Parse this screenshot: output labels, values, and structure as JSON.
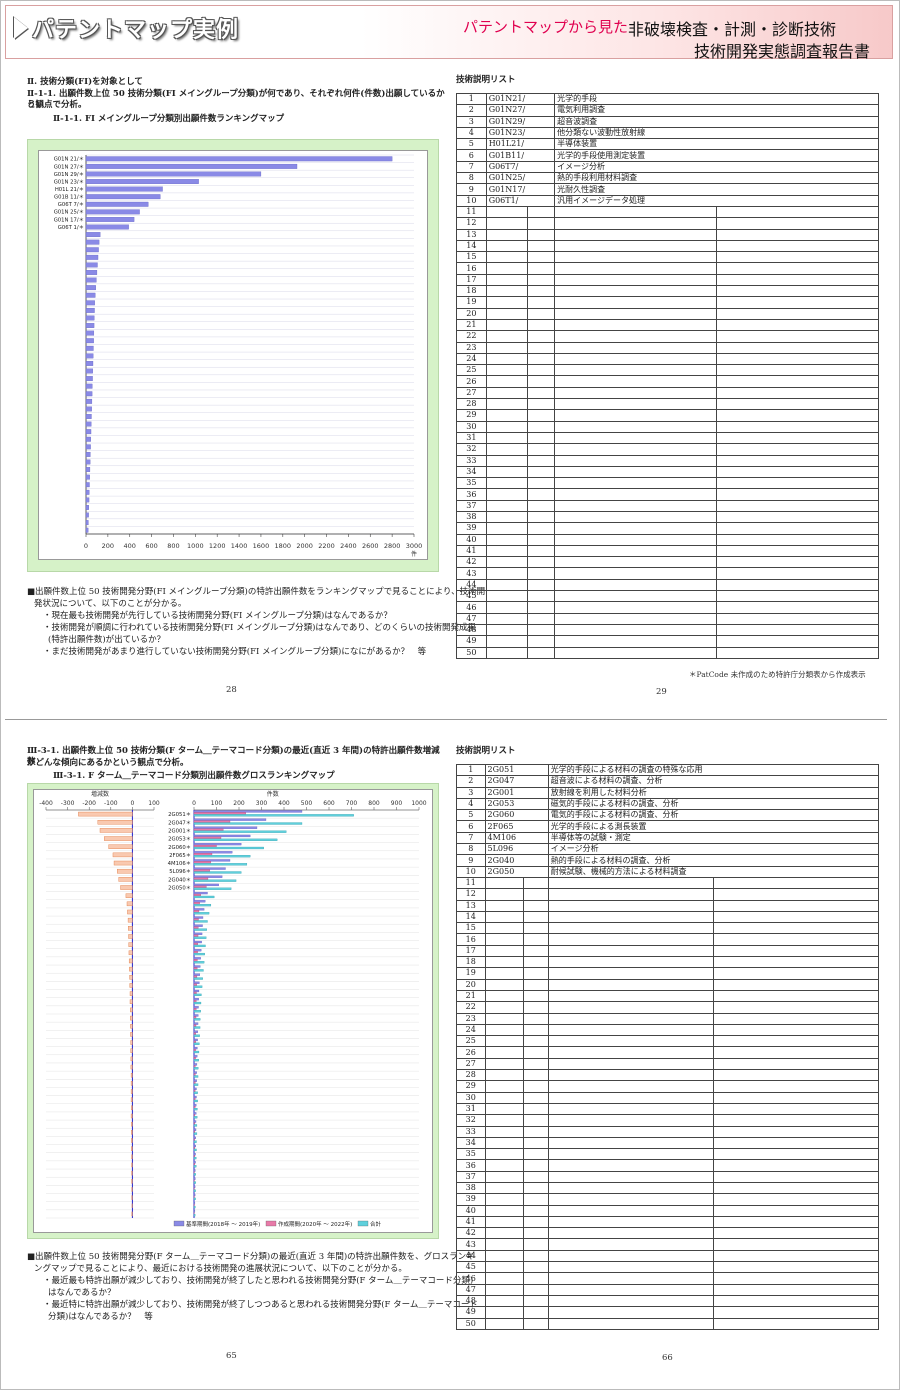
{
  "banner": {
    "title": "パテントマップ実例",
    "sub_pink": "パテントマップから見た",
    "sub_main": "非破壊検査・計測・診断技術",
    "sub_report": "技術開発実態調査報告書"
  },
  "p1": {
    "heading1": "Ⅱ. 技術分類(FI)を対象として",
    "heading2a": "Ⅱ-1-1. 出願件数上位 50 技術分類(FI メイングループ分類)が何であり、それぞれ何件(件数)出願しているかとい",
    "heading2b": "う観点で分析。",
    "chart_title": "Ⅱ-1-1. FI メイングループ分類別出願件数ランキングマップ",
    "para1": "■出願件数上位 50 技術開発分野(FI メイングループ分類)の特許出願件数をランキングマップで見ることにより、技術開",
    "para2": "発状況について、以下のことが分かる。",
    "b1": "・現在最も技術開発が先行している技術開発分野(FI メイングループ分類)はなんであるか？",
    "b2": "・技術開発が順調に行われている技術開発分野(FI メイングループ分類)はなんであり、どのくらいの技術開発成果",
    "b2b": "(特許出願件数)が出ているか？",
    "b3": "・まだ技術開発があまり進行していない技術開発分野(FI メイングループ分類)になにがあるか？　等",
    "page_num": "28"
  },
  "t1": {
    "title": "技術説明リスト",
    "rows": [
      {
        "n": "1",
        "code": "G01N21/",
        "desc": "光学的手段"
      },
      {
        "n": "2",
        "code": "G01N27/",
        "desc": "電気利用調査"
      },
      {
        "n": "3",
        "code": "G01N29/",
        "desc": "超音波調査"
      },
      {
        "n": "4",
        "code": "G01N23/",
        "desc": "他分類ない波動性放射線"
      },
      {
        "n": "5",
        "code": "H01L21/",
        "desc": "半導体装置"
      },
      {
        "n": "6",
        "code": "G01B11/",
        "desc": "光学的手段使用測定装置"
      },
      {
        "n": "7",
        "code": "G06T7/",
        "desc": "イメージ分析"
      },
      {
        "n": "8",
        "code": "G01N25/",
        "desc": "熱的手段利用材料調査"
      },
      {
        "n": "9",
        "code": "G01N17/",
        "desc": "光耐久性調査"
      },
      {
        "n": "10",
        "code": "G06T1/",
        "desc": "汎用イメージデータ処理"
      }
    ],
    "note": "＊PatCode 未作成のため特許庁分類表から作成表示",
    "page_num": "29"
  },
  "p2": {
    "heading1a": "Ⅲ-3-1. 出願件数上位 50 技術分類(F ターム＿テーマコード分類)の最近(直近 3 年間)の特許出願件数増減数",
    "heading1b": "がどんな傾向にあるかという観点で分析。",
    "chart_title": "Ⅲ-3-1. F ターム＿テーマコード分類別出願件数グロスランキングマップ",
    "para1": "■出願件数上位 50 技術開発分野(F ターム＿テーマコード分類)の最近(直近 3 年間)の特許出願件数を、グロスランキ",
    "para2": "ングマップで見ることにより、最近における技術開発の進展状況について、以下のことが分かる。",
    "b1": "・最近最も特許出願が減少しており、技術開発が終了したと思われる技術開発分野(F ターム＿テーマコード分類)",
    "b1b": "はなんであるか？",
    "b2": "・最近特に特許出願が減少しており、技術開発が終了しつつあると思われる技術開発分野(F ターム＿テーマコード",
    "b2b": "分類)はなんであるか？　等",
    "page_num": "65"
  },
  "t2": {
    "title": "技術説明リスト",
    "rows": [
      {
        "n": "1",
        "code": "2G051",
        "desc": "光学的手段による材料の調査の特殊な応用"
      },
      {
        "n": "2",
        "code": "2G047",
        "desc": "超音波による材料の調査、分析"
      },
      {
        "n": "3",
        "code": "2G001",
        "desc": "放射線を利用した材料分析"
      },
      {
        "n": "4",
        "code": "2G053",
        "desc": "磁気的手段による材料の調査、分析"
      },
      {
        "n": "5",
        "code": "2G060",
        "desc": "電気的手段による材料の調査、分析"
      },
      {
        "n": "6",
        "code": "2F065",
        "desc": "光学的手段による測長装置"
      },
      {
        "n": "7",
        "code": "4M106",
        "desc": "半導体等の試験・測定"
      },
      {
        "n": "8",
        "code": "5L096",
        "desc": "イメージ分析"
      },
      {
        "n": "9",
        "code": "2G040",
        "desc": "熱的手段による材料の調査、分析"
      },
      {
        "n": "10",
        "code": "2G050",
        "desc": "耐候試験、機械的方法による材料調査"
      }
    ],
    "page_num": "66"
  },
  "chart_data": [
    {
      "type": "bar",
      "orientation": "horizontal",
      "categories": [
        "G01N 21/＊",
        "G01N 27/＊",
        "G01N 29/＊",
        "G01N 23/＊",
        "H01L 21/＊",
        "G01B 11/＊",
        "G06T 7/＊",
        "G01N 25/＊",
        "G01N 17/＊",
        "G06T 1/＊"
      ],
      "values": [
        2800,
        1930,
        1600,
        1030,
        700,
        680,
        570,
        490,
        440,
        390,
        130,
        120,
        115,
        110,
        105,
        100,
        95,
        90,
        85,
        80,
        78,
        76,
        74,
        72,
        70,
        68,
        66,
        64,
        62,
        60,
        58,
        56,
        54,
        52,
        50,
        48,
        46,
        44,
        42,
        40,
        38,
        36,
        34,
        32,
        30,
        28,
        26,
        24,
        22,
        20
      ],
      "xlabel": "件",
      "xlim": [
        0,
        3000
      ],
      "xticks": [
        "0",
        "200",
        "400",
        "600",
        "800",
        "1000",
        "1200",
        "1400",
        "1600",
        "1800",
        "2000",
        "2200",
        "2400",
        "2600",
        "2800",
        "3000"
      ]
    },
    {
      "type": "bar",
      "orientation": "horizontal",
      "left_axis_label": "増減数",
      "left_xlim": [
        -400,
        100
      ],
      "left_xticks": [
        "-400",
        "-300",
        "-200",
        "-100",
        "0",
        "100"
      ],
      "right_axis_label": "件数",
      "right_xlim": [
        0,
        1000
      ],
      "right_xticks": [
        "0",
        "100",
        "200",
        "300",
        "400",
        "500",
        "600",
        "700",
        "800",
        "900",
        "1000"
      ],
      "categories": [
        "2G051＊",
        "2G047＊",
        "2G001＊",
        "2G053＊",
        "2G060＊",
        "2F065＊",
        "4M106＊",
        "5L096＊",
        "2G040＊",
        "2G050＊"
      ],
      "series": [
        {
          "name": "基準期間(2018年 ～ 2019年)",
          "values": [
            480,
            320,
            280,
            250,
            210,
            170,
            160,
            140,
            125,
            110,
            60,
            50,
            45,
            40,
            38,
            36,
            34,
            32,
            30,
            28,
            26,
            24,
            22,
            21,
            20,
            19,
            18,
            17,
            16,
            15,
            14,
            13,
            12,
            12,
            11,
            11,
            10,
            10,
            9,
            9,
            8,
            8,
            7,
            7,
            6,
            6,
            5,
            5,
            4,
            4
          ]
        },
        {
          "name": "作成期間(2020年 ～ 2022年)",
          "values": [
            230,
            160,
            130,
            120,
            100,
            80,
            75,
            70,
            62,
            55,
            30,
            25,
            22,
            20,
            19,
            18,
            17,
            16,
            15,
            14,
            13,
            12,
            11,
            10,
            10,
            9,
            9,
            8,
            8,
            7,
            7,
            6,
            6,
            6,
            5,
            5,
            5,
            4,
            4,
            4,
            3,
            3,
            3,
            3,
            2,
            2,
            2,
            2,
            2,
            1
          ]
        },
        {
          "name": "合計",
          "values": [
            710,
            480,
            410,
            370,
            310,
            250,
            235,
            210,
            187,
            165,
            90,
            75,
            67,
            60,
            57,
            54,
            51,
            48,
            45,
            42,
            39,
            36,
            33,
            31,
            30,
            28,
            27,
            25,
            24,
            22,
            21,
            19,
            18,
            18,
            16,
            16,
            15,
            14,
            13,
            13,
            11,
            11,
            10,
            10,
            8,
            8,
            7,
            7,
            6,
            5
          ]
        },
        {
          "name": "増減数",
          "values": [
            -250,
            -160,
            -150,
            -130,
            -110,
            -90,
            -85,
            -70,
            -63,
            -55,
            -30,
            -25,
            -23,
            -20,
            -19,
            -18,
            -17,
            -16,
            -15,
            -14,
            -13,
            -12,
            -11,
            -11,
            -10,
            -10,
            -9,
            -9,
            -8,
            -8,
            -7,
            -7,
            -6,
            -6,
            -6,
            -6,
            -5,
            -6,
            -5,
            -5,
            -5,
            -5,
            -4,
            -4,
            -4,
            -4,
            -3,
            -3,
            -2,
            -3
          ]
        }
      ],
      "colors": {
        "base": "#8a8ae6",
        "recent": "#e87aa8",
        "total": "#5fd0dc",
        "delta": "#f2a880"
      }
    }
  ]
}
